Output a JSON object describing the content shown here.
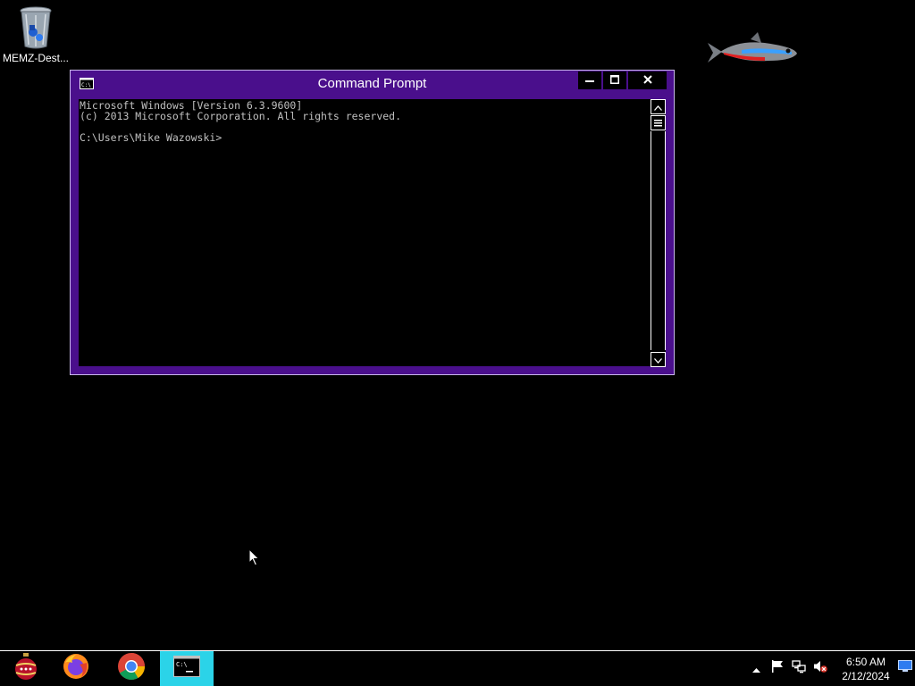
{
  "desktop": {
    "icons": [
      {
        "label": "MEMZ-Dest...",
        "icon": "recycle-bin-icon"
      }
    ]
  },
  "console": {
    "title": "Command Prompt",
    "icon": "cmd-icon",
    "lines": [
      "Microsoft Windows [Version 6.3.9600]",
      "(c) 2013 Microsoft Corporation. All rights reserved.",
      "",
      "C:\\Users\\Mike Wazowski>"
    ],
    "colors": {
      "frame": "#4a0f8c",
      "text": "#c0c0c0",
      "background": "#000000"
    }
  },
  "taskbar": {
    "apps": [
      {
        "name": "ornament",
        "icon": "ornament-icon"
      },
      {
        "name": "firefox",
        "icon": "firefox-icon"
      },
      {
        "name": "chrome",
        "icon": "chrome-icon"
      },
      {
        "name": "cmd",
        "icon": "cmd-icon",
        "active": true,
        "active_color": "#2bd3e8"
      }
    ],
    "clock": {
      "time": "6:50 AM",
      "date": "2/12/2024"
    }
  }
}
